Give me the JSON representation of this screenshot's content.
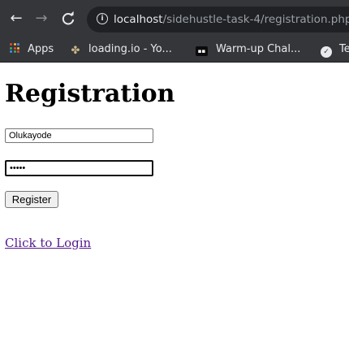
{
  "browser": {
    "back_icon": "←",
    "forward_icon": "→",
    "reload_icon": "C",
    "info_icon": "i",
    "url_host": "localhost",
    "url_path": "/sidehustle-task-4/registration.php"
  },
  "bookmarks": [
    {
      "label": "Apps",
      "icon": "apps-grid-icon"
    },
    {
      "label": "loading.io - Yo...",
      "icon": "loading-io-icon"
    },
    {
      "label": "Warm-up Chal...",
      "icon": "warmup-icon"
    },
    {
      "label": "Te",
      "icon": "globe-icon"
    }
  ],
  "page": {
    "title": "Registration",
    "username_value": "Olukayode",
    "password_value": "•••••",
    "register_label": "Register",
    "login_link": "Click to Login"
  },
  "colors": {
    "chrome": "#35363a",
    "omnibox": "#202124",
    "link_visited": "#551a8b"
  }
}
